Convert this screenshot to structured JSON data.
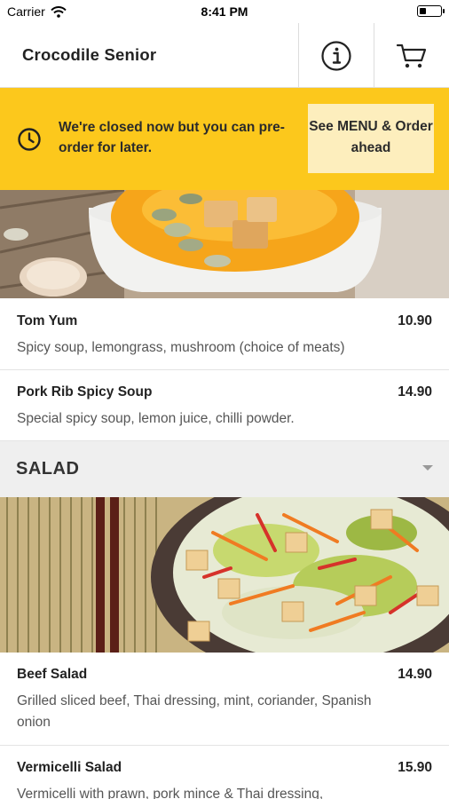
{
  "status_bar": {
    "carrier": "Carrier",
    "time": "8:41 PM",
    "battery_level": 0.3
  },
  "header": {
    "title": "Crocodile Senior",
    "info_icon": "info-icon",
    "cart_icon": "cart-icon"
  },
  "banner": {
    "message": "We're closed now but you can pre-order for later.",
    "button_label": "See MENU & Order ahead",
    "color": "#fcc81c",
    "clock_icon": "clock-icon"
  },
  "soup_items": [
    {
      "name": "Tom Yum",
      "price": "10.90",
      "description": "Spicy soup, lemongrass, mushroom (choice of meats)"
    },
    {
      "name": "Pork Rib Spicy Soup",
      "price": "14.90",
      "description": "Special spicy soup, lemon juice, chilli powder."
    }
  ],
  "salad_section": {
    "title": "SALAD",
    "caret_icon": "chevron-down-icon"
  },
  "salad_items": [
    {
      "name": "Beef Salad",
      "price": "14.90",
      "description": "Grilled sliced beef, Thai dressing, mint, coriander, Spanish onion"
    },
    {
      "name": "Vermicelli Salad",
      "price": "15.90",
      "description": "Vermicelli with prawn, pork mince & Thai dressing,"
    }
  ]
}
